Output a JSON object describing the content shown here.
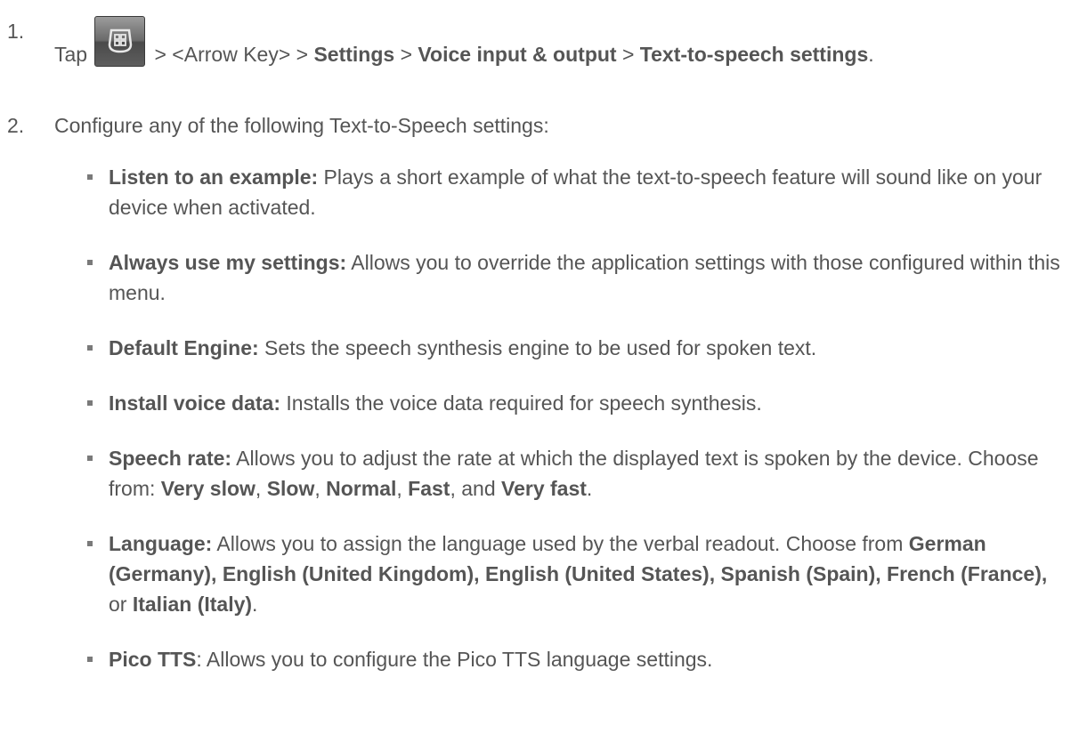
{
  "steps": [
    {
      "number": "1.",
      "tap": "Tap",
      "sep1": " > <Arrow Key> > ",
      "settings": "Settings",
      "sep2": " > ",
      "voice": "Voice input & output",
      "sep3": " > ",
      "tts_settings": "Text-to-speech settings",
      "end": ".",
      "icon": "home-key-icon"
    },
    {
      "number": "2.",
      "text": "Configure any of the following Text-to-Speech settings:"
    }
  ],
  "items": [
    {
      "term": "Listen to an example:",
      "desc": " Plays a short example of what the text-to-speech feature will sound like on your device when activated."
    },
    {
      "term": "Always use my settings:",
      "desc": " Allows you to override the application settings with those configured within this menu."
    },
    {
      "term": "Default Engine:",
      "desc": " Sets the speech synthesis engine to be used for spoken text."
    },
    {
      "term": "Install voice data:",
      "desc": " Installs the voice data required for speech synthesis."
    },
    {
      "term": "Speech rate:",
      "desc": " Allows you to adjust the rate at which the displayed text is spoken by the device. Choose from: ",
      "opt1": "Very slow",
      "c1": ", ",
      "opt2": "Slow",
      "c2": ", ",
      "opt3": "Normal",
      "c3": ", ",
      "opt4": "Fast",
      "c4": ", and ",
      "opt5": "Very fast",
      "end": "."
    },
    {
      "term": "Language:",
      "desc": " Allows you to assign the language used by the verbal readout. Choose from ",
      "langs1": "German (Germany), English (United Kingdom), English (United States), Spanish (Spain), French (France),",
      "or": " or ",
      "lang_last": "Italian (Italy)",
      "end": "."
    },
    {
      "term": "Pico TTS",
      "desc": ": Allows you to configure the Pico TTS language settings."
    }
  ]
}
